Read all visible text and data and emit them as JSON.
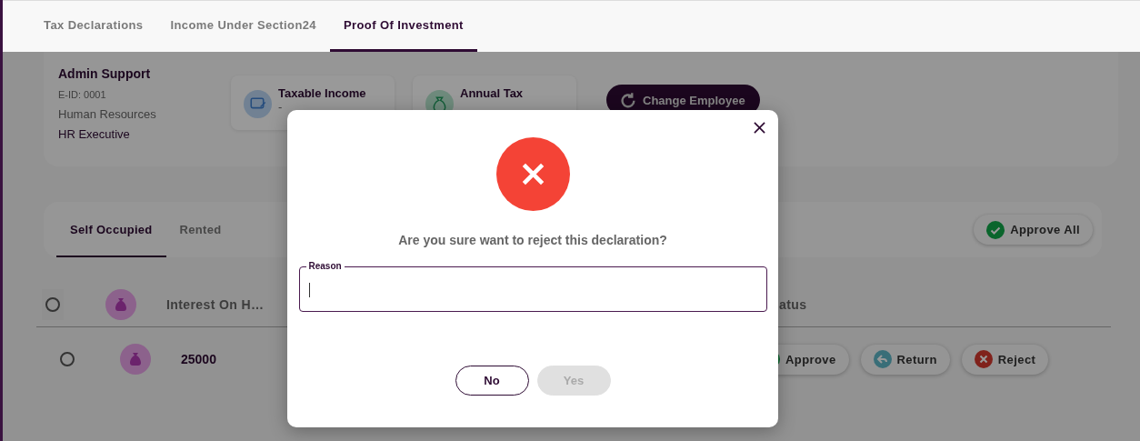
{
  "tabs": [
    {
      "label": "Tax Declarations",
      "selected": false
    },
    {
      "label": "Income Under Section24",
      "selected": false
    },
    {
      "label": "Proof Of Investment",
      "selected": true
    }
  ],
  "employee": {
    "name": "Admin Support",
    "eid": "E-ID: 0001",
    "department": "Human Resources",
    "designation": "HR Executive"
  },
  "stats": [
    {
      "kind": "income",
      "label": "Taxable Income",
      "value": "-"
    },
    {
      "kind": "tax",
      "label": "Annual Tax"
    }
  ],
  "change_button": "Change Employee",
  "sub_tabs": [
    {
      "label": "Self Occupied",
      "selected": true
    },
    {
      "label": "Rented",
      "selected": false
    }
  ],
  "approve_all": "Approve All",
  "table": {
    "columns": {
      "column_1": "Interest On H…",
      "column_2": "atus"
    },
    "rows": [
      {
        "checked": false,
        "amount": "25000",
        "actions": [
          {
            "kind": "approve",
            "label": "Approve"
          },
          {
            "kind": "return",
            "label": "Return"
          },
          {
            "kind": "reject",
            "label": "Reject"
          }
        ]
      }
    ],
    "header_checked": false
  },
  "dialog": {
    "message": "Are you sure want to reject this declaration?",
    "field": {
      "label": "Reason"
    },
    "buttons": [
      {
        "label": "No",
        "disabled": false
      },
      {
        "label": "Yes",
        "disabled": true
      }
    ]
  }
}
